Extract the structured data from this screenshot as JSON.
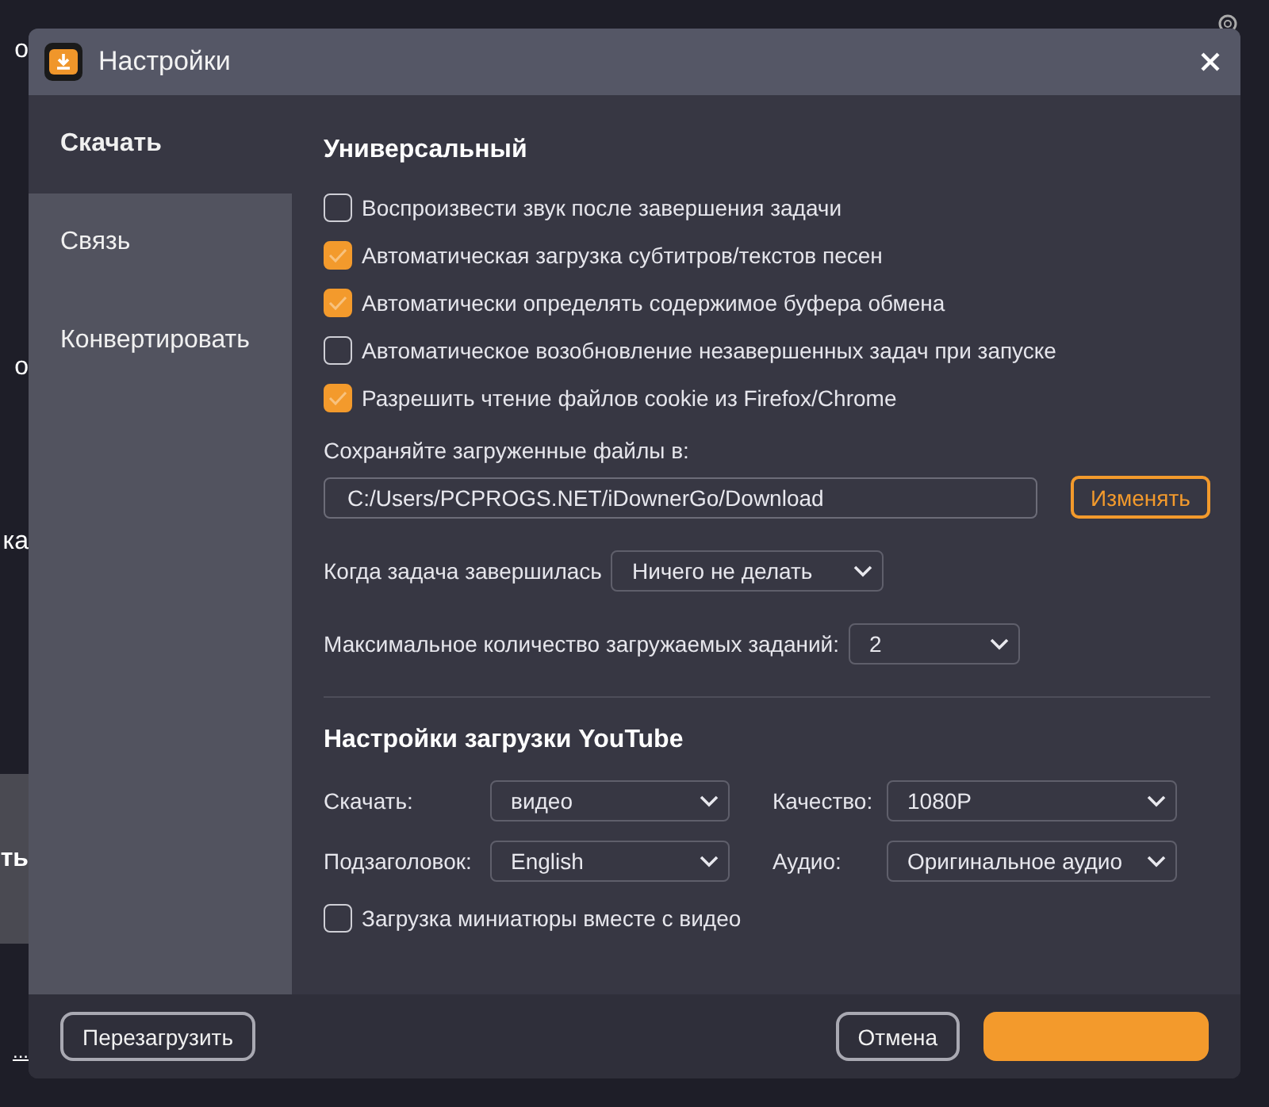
{
  "background": {
    "fragments": [
      {
        "text": "о",
        "selected": false
      },
      {
        "text": "о",
        "selected": false
      },
      {
        "text": "ка",
        "selected": false
      },
      {
        "text": "ть",
        "selected": true
      },
      {
        "text": "...",
        "selected": false
      }
    ]
  },
  "window": {
    "title": "Настройки"
  },
  "sidebar": {
    "items": [
      {
        "label": "Скачать",
        "selected": true
      },
      {
        "label": "Связь",
        "selected": false
      },
      {
        "label": "Конвертировать",
        "selected": false
      }
    ]
  },
  "general": {
    "heading": "Универсальный",
    "options": [
      {
        "label": "Воспроизвести звук после завершения задачи",
        "checked": false
      },
      {
        "label": "Автоматическая загрузка субтитров/текстов песен",
        "checked": true
      },
      {
        "label": "Автоматически определять содержимое буфера обмена",
        "checked": true
      },
      {
        "label": "Автоматическое возобновление незавершенных задач при запуске",
        "checked": false
      },
      {
        "label": "Разрешить чтение файлов cookie из Firefox/Chrome",
        "checked": true
      }
    ],
    "save_label": "Сохраняйте загруженные файлы в:",
    "save_path": "C:/Users/PCPROGS.NET/iDownerGo/Download",
    "change_button": "Изменять",
    "on_complete": {
      "label": "Когда задача завершилась",
      "value": "Ничего не делать"
    },
    "max_tasks": {
      "label": "Максимальное количество загружаемых заданий:",
      "value": "2"
    }
  },
  "youtube": {
    "heading": "Настройки загрузки YouTube",
    "fields": [
      {
        "label": "Скачать:",
        "value": "видео"
      },
      {
        "label": "Качество:",
        "value": "1080P"
      },
      {
        "label": "Подзаголовок:",
        "value": "English"
      },
      {
        "label": "Аудио:",
        "value": "Оригинальное аудио"
      }
    ],
    "thumbnail": {
      "label": "Загрузка миниатюры вместе с видео",
      "checked": false
    }
  },
  "footer": {
    "reset_button": "Перезагрузить",
    "cancel_button": "Отмена"
  }
}
